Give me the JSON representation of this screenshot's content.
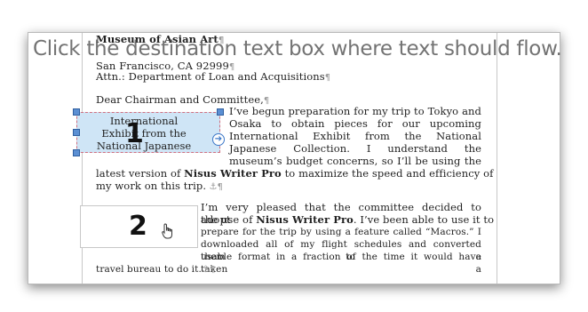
{
  "instruction": "Click the destination text box where text should flow.",
  "letter": {
    "header1": "Museum of Asian Art",
    "header2": "San Francisco, CA 92999",
    "header3": "Attn.: Department of Loan and Acquisitions",
    "salutation": "Dear Chairman and Committee,",
    "pilcrow": "¶",
    "anchor": "⚓",
    "p1_lines": [
      "I’ve begun preparation for my trip to Tokyo and",
      "Osaka to obtain pieces for our upcoming",
      "International Exhibit from the National",
      "Japanese Collection. I understand the",
      "museum’s budget concerns, so I’ll be using the"
    ],
    "p1_line6a": "latest version of ",
    "p1_line6b": "Nisus Writer Pro",
    "p1_line6c": " to maximize the speed and efficiency of",
    "p1_line7": "my work on this trip.",
    "p2_line1": "I’m very pleased that the committee decided to adopt",
    "p2_line2a": "the use of ",
    "p2_line2b": "Nisus Writer Pro",
    "p2_line2c": ". I’ve been able to use it to",
    "p2_lines": [
      "prepare for the trip by using a feature called “Macros.” I",
      "downloaded all of my flight schedules and converted them to a",
      "usable format in a fraction of the time it would have taken a"
    ],
    "p2_last": "travel bureau to do it."
  },
  "textbox1": {
    "lines": [
      "International",
      "Exhibit from the",
      "National Japanese"
    ],
    "number": "1"
  },
  "textbox2": {
    "number": "2"
  },
  "link_icon": "arrow-right-circle-icon",
  "cursor_icon": "hand-pointer-icon"
}
